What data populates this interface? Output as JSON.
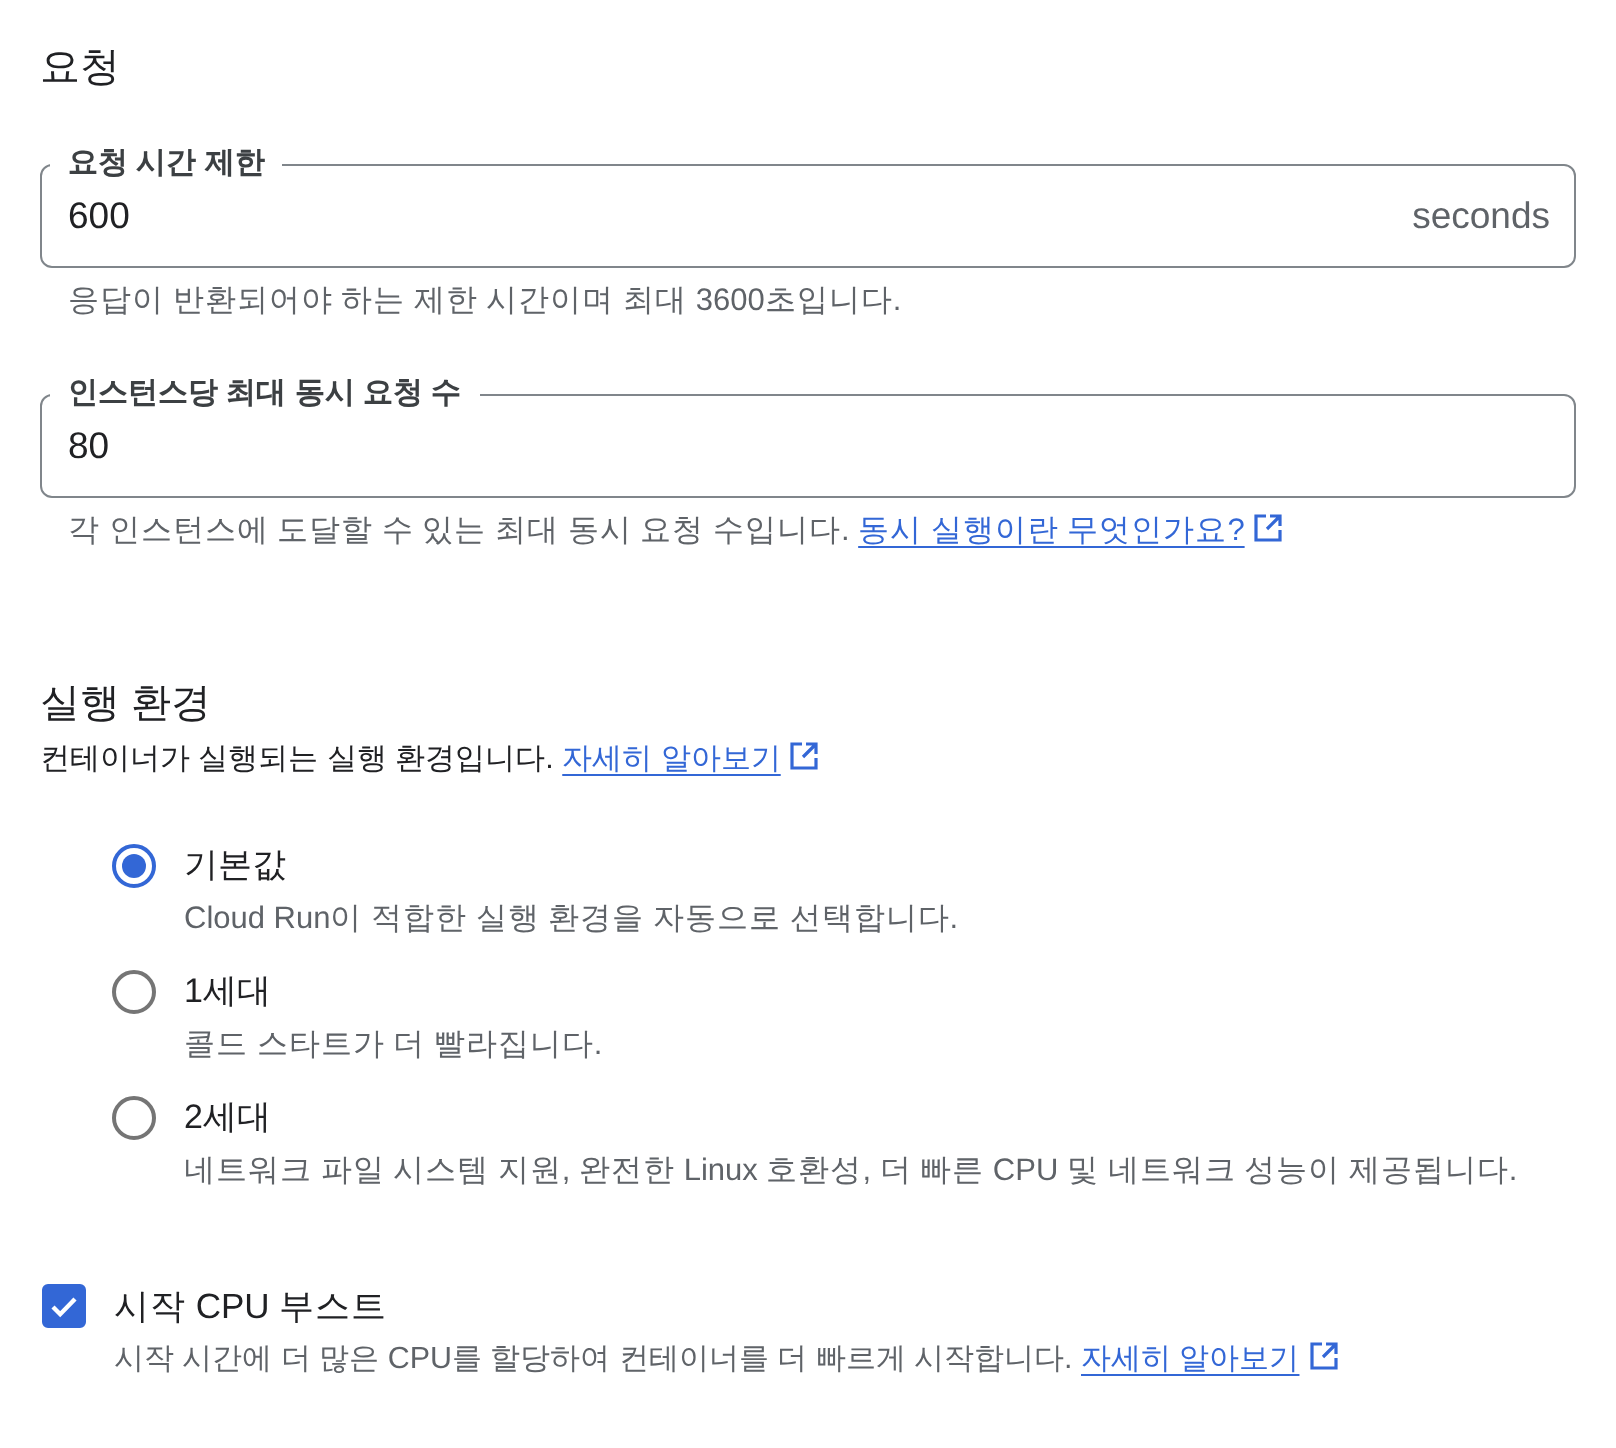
{
  "request": {
    "title": "요청",
    "fields": [
      {
        "label": "요청 시간 제한",
        "value": "600",
        "suffix": "seconds",
        "helper": "응답이 반환되어야 하는 제한 시간이며 최대 3600초입니다."
      },
      {
        "label": "인스턴스당 최대 동시 요청 수",
        "value": "80",
        "helper": "각 인스턴스에 도달할 수 있는 최대 동시 요청 수입니다.",
        "helper_link": "동시 실행이란 무엇인가요?"
      }
    ]
  },
  "execution_environment": {
    "title": "실행 환경",
    "description": "컨테이너가 실행되는 실행 환경입니다.",
    "link": "자세히 알아보기",
    "options": [
      {
        "label": "기본값",
        "description": "Cloud Run이 적합한 실행 환경을 자동으로 선택합니다.",
        "selected": true
      },
      {
        "label": "1세대",
        "description": "콜드 스타트가 더 빨라집니다.",
        "selected": false
      },
      {
        "label": "2세대",
        "description": "네트워크 파일 시스템 지원, 완전한 Linux 호환성, 더 빠른 CPU 및 네트워크 성능이 제공됩니다.",
        "selected": false
      }
    ]
  },
  "startup_boost": {
    "label": "시작 CPU 부스트",
    "checked": true,
    "description": "시작 시간에 더 많은 CPU를 할당하여 컨테이너를 더 빠르게 시작합니다.",
    "link": "자세히 알아보기"
  }
}
